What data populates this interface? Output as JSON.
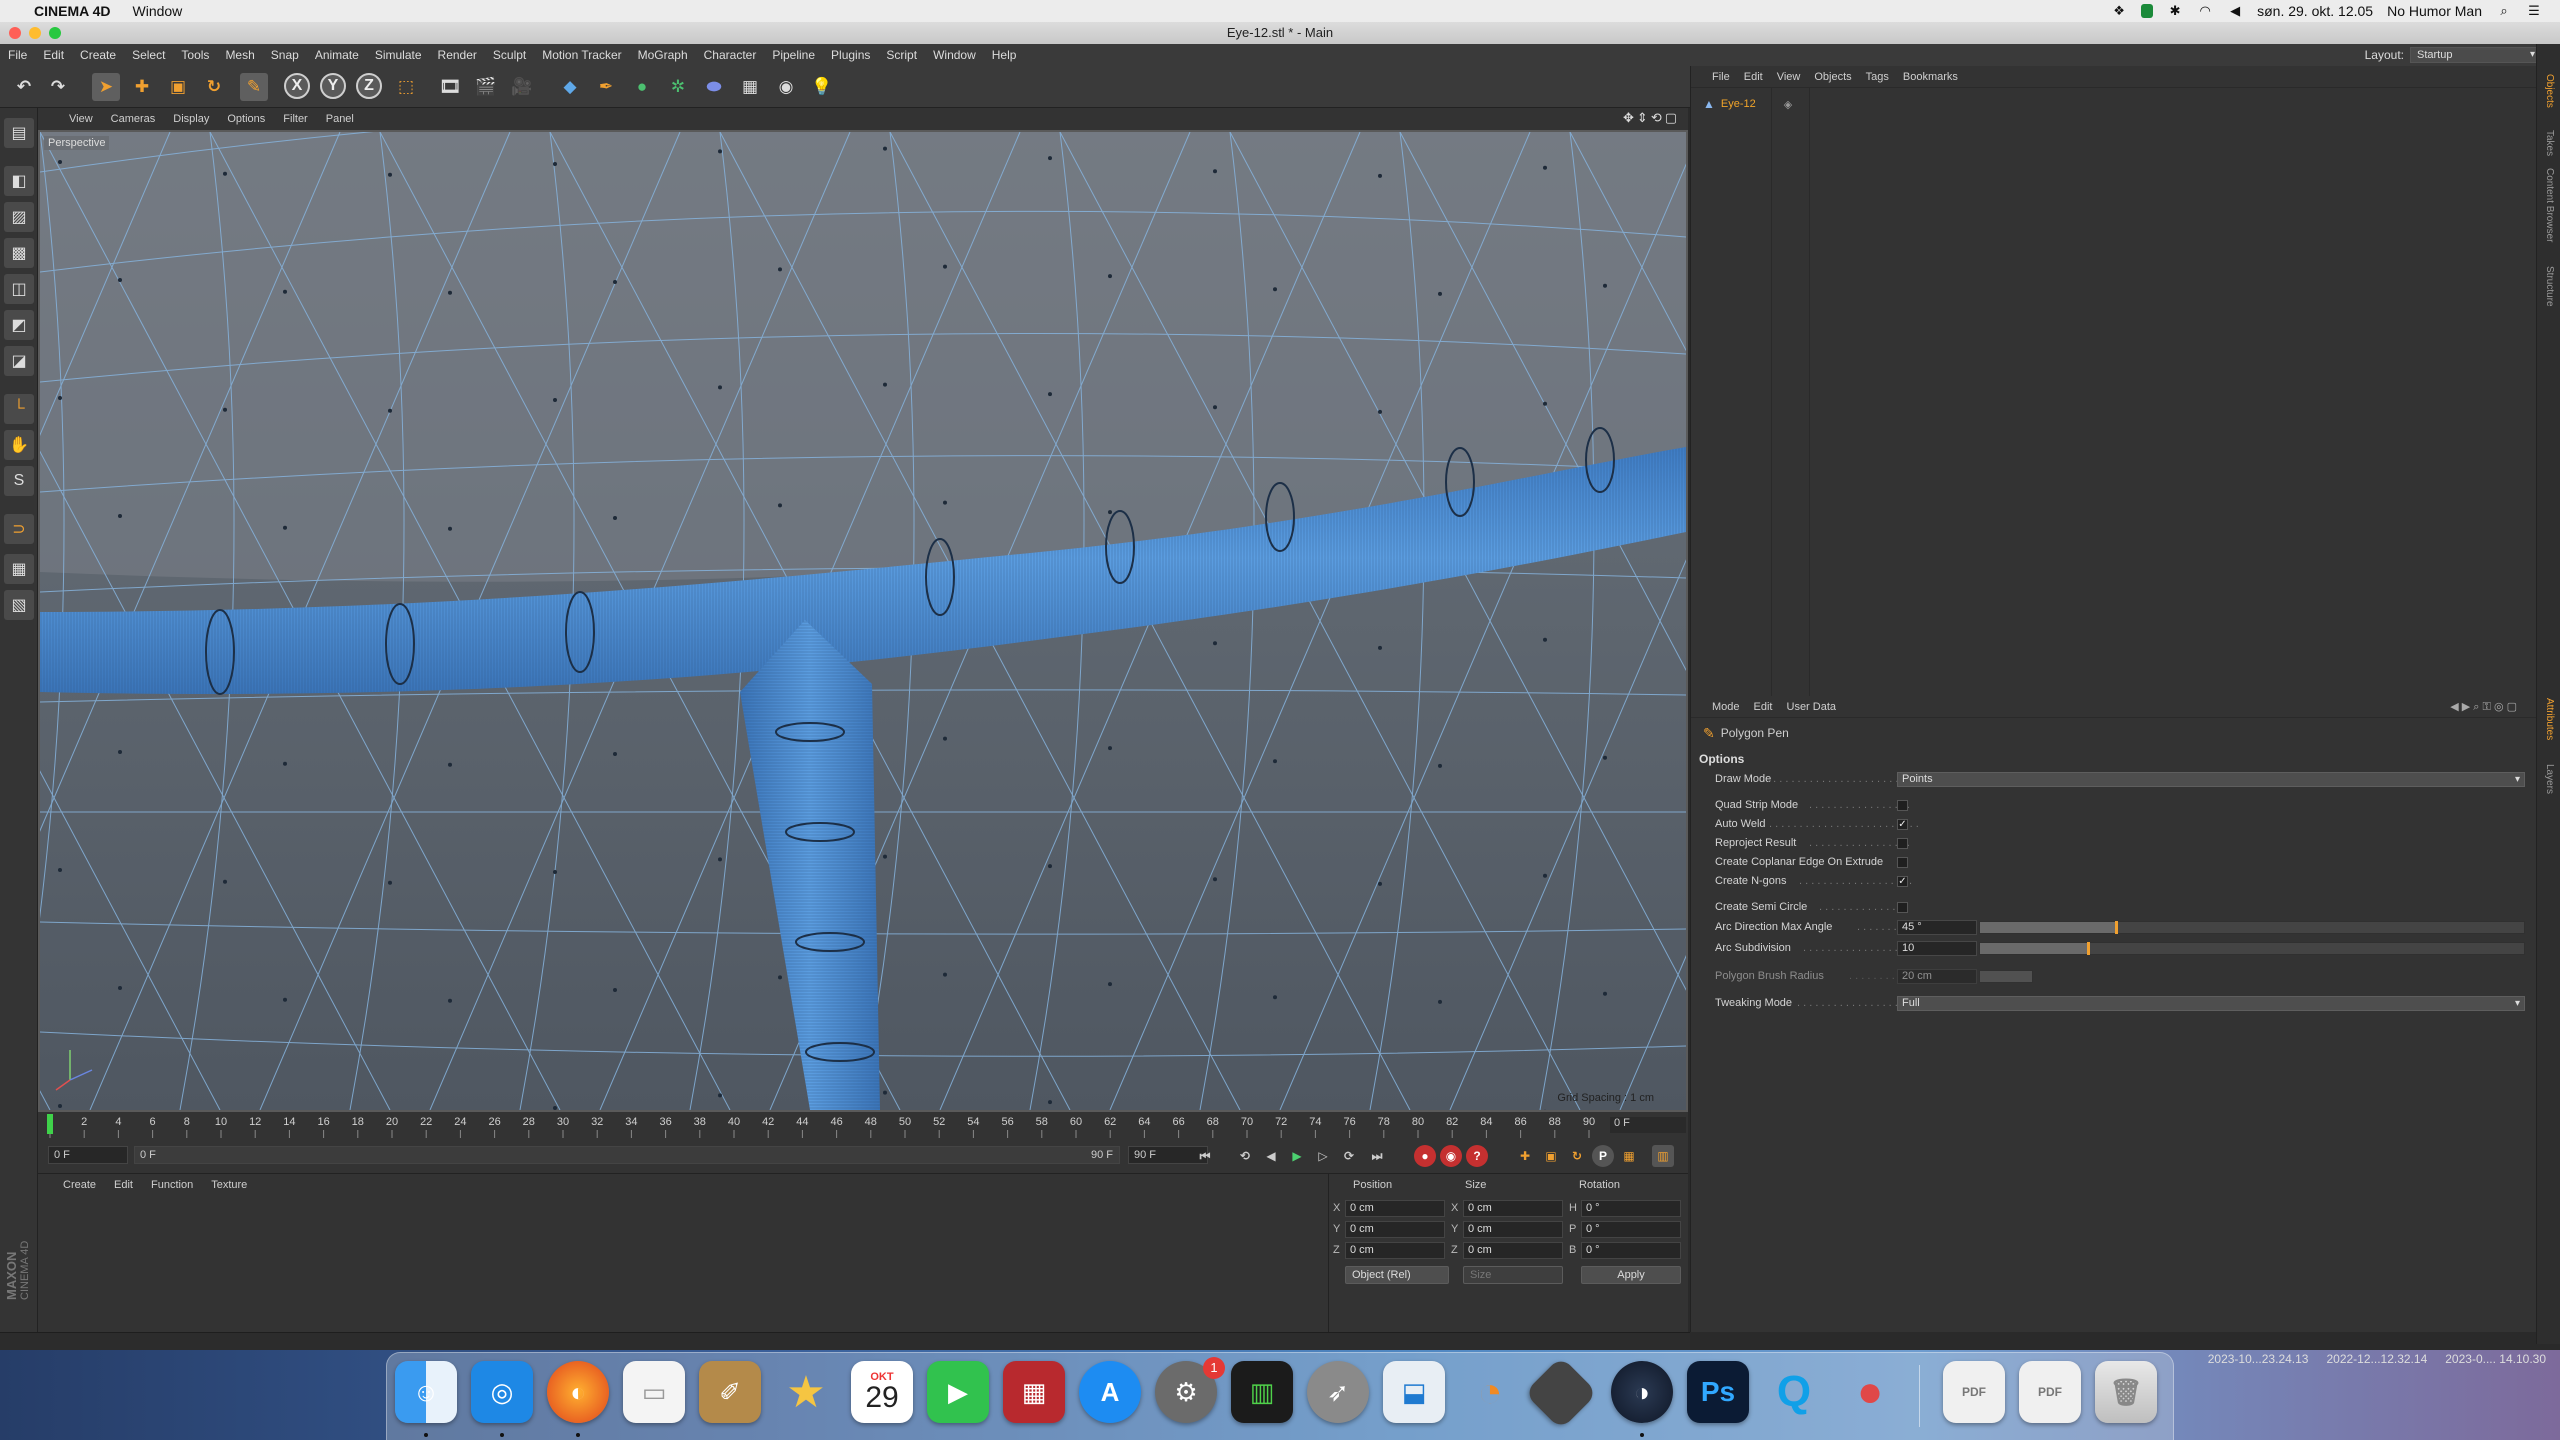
{
  "menubar": {
    "app_name": "CINEMA 4D",
    "items": [
      "Window"
    ],
    "date_time": "søn. 29. okt. 12.05",
    "user": "No Humor Man"
  },
  "window": {
    "title": "Eye-12.stl * - Main"
  },
  "main_menu": {
    "items": [
      "File",
      "Edit",
      "Create",
      "Select",
      "Tools",
      "Mesh",
      "Snap",
      "Animate",
      "Simulate",
      "Render",
      "Sculpt",
      "Motion Tracker",
      "MoGraph",
      "Character",
      "Pipeline",
      "Plugins",
      "Script",
      "Window",
      "Help"
    ],
    "layout_label": "Layout:",
    "layout_value": "Startup"
  },
  "toolbar": {
    "axis_x": "X",
    "axis_y": "Y",
    "axis_z": "Z"
  },
  "viewport": {
    "menu": [
      "View",
      "Cameras",
      "Display",
      "Options",
      "Filter",
      "Panel"
    ],
    "label": "Perspective",
    "grid_spacing": "Grid Spacing : 1 cm",
    "background_color": "#5b636d",
    "wire_color": "#7fb0dd",
    "tube_color": "#4d8fd4"
  },
  "timeline": {
    "ticks": [
      "0",
      "2",
      "4",
      "6",
      "8",
      "10",
      "12",
      "14",
      "16",
      "18",
      "20",
      "22",
      "24",
      "26",
      "28",
      "30",
      "32",
      "34",
      "36",
      "38",
      "40",
      "42",
      "44",
      "46",
      "48",
      "50",
      "52",
      "54",
      "56",
      "58",
      "60",
      "62",
      "64",
      "66",
      "68",
      "70",
      "72",
      "74",
      "76",
      "78",
      "80",
      "82",
      "84",
      "86",
      "88",
      "90"
    ],
    "current_frame": "0 F",
    "start_field": "0 F",
    "range_start": "0 F",
    "range_end": "90 F",
    "end_field": "90 F"
  },
  "material_manager": {
    "menu": [
      "Create",
      "Edit",
      "Function",
      "Texture"
    ]
  },
  "coordinates": {
    "headers": {
      "position": "Position",
      "size": "Size",
      "rotation": "Rotation"
    },
    "rows": [
      {
        "axis": "X",
        "pos": "0 cm",
        "size_axis": "X",
        "size": "0 cm",
        "rot_axis": "H",
        "rot": "0 °"
      },
      {
        "axis": "Y",
        "pos": "0 cm",
        "size_axis": "Y",
        "size": "0 cm",
        "rot_axis": "P",
        "rot": "0 °"
      },
      {
        "axis": "Z",
        "pos": "0 cm",
        "size_axis": "Z",
        "size": "0 cm",
        "rot_axis": "B",
        "rot": "0 °"
      }
    ],
    "mode": "Object (Rel)",
    "size_mode": "Size",
    "apply": "Apply"
  },
  "object_manager": {
    "menu": [
      "File",
      "Edit",
      "View",
      "Objects",
      "Tags",
      "Bookmarks"
    ],
    "objects": [
      {
        "name": "Eye-12"
      }
    ]
  },
  "attribute_manager": {
    "menu": [
      "Mode",
      "Edit",
      "User Data"
    ],
    "tool_name": "Polygon Pen",
    "section": "Options",
    "draw_mode_label": "Draw Mode",
    "draw_mode_value": "Points",
    "checkboxes": [
      {
        "label": "Quad Strip Mode",
        "checked": false
      },
      {
        "label": "Auto Weld",
        "checked": true
      },
      {
        "label": "Reproject Result",
        "checked": false
      },
      {
        "label": "Create Coplanar Edge On Extrude",
        "checked": false
      },
      {
        "label": "Create N-gons",
        "checked": true
      }
    ],
    "semi_circle_label": "Create Semi Circle",
    "semi_circle_checked": false,
    "arc_angle_label": "Arc Direction Max Angle",
    "arc_angle_value": "45 °",
    "arc_angle_fraction": 0.25,
    "arc_subdiv_label": "Arc Subdivision",
    "arc_subdiv_value": "10",
    "arc_subdiv_fraction": 0.2,
    "brush_radius_label": "Polygon Brush Radius",
    "brush_radius_value": "20 cm",
    "tweak_label": "Tweaking Mode",
    "tweak_value": "Full"
  },
  "side_tabs": [
    "Objects",
    "Takes",
    "Content Browser",
    "Structure",
    "Attributes",
    "Layers"
  ],
  "branding": {
    "maxon": "MAXON",
    "product": "CINEMA 4D"
  },
  "desktop_files": [
    "2023-10...23.24.13",
    "2022-12...12.32.14",
    "2023-0.... 14.10.30"
  ],
  "dock": {
    "calendar_month": "OKT",
    "calendar_day": "29",
    "badge": "1",
    "apps": [
      "Finder",
      "Safari",
      "Firefox",
      "TextEdit",
      "Notes",
      "iMovie",
      "Calendar",
      "FaceTime",
      "Photo Booth",
      "App Store",
      "System Preferences",
      "Activity Monitor",
      "Rocket",
      "Folder",
      "Blender",
      "Unity",
      "Cinema 4D",
      "Photoshop",
      "QuickTime",
      "Fruit",
      "PDF 1",
      "PDF 2",
      "Trash"
    ],
    "ps_label": "Ps",
    "pdf_label": "PDF"
  }
}
